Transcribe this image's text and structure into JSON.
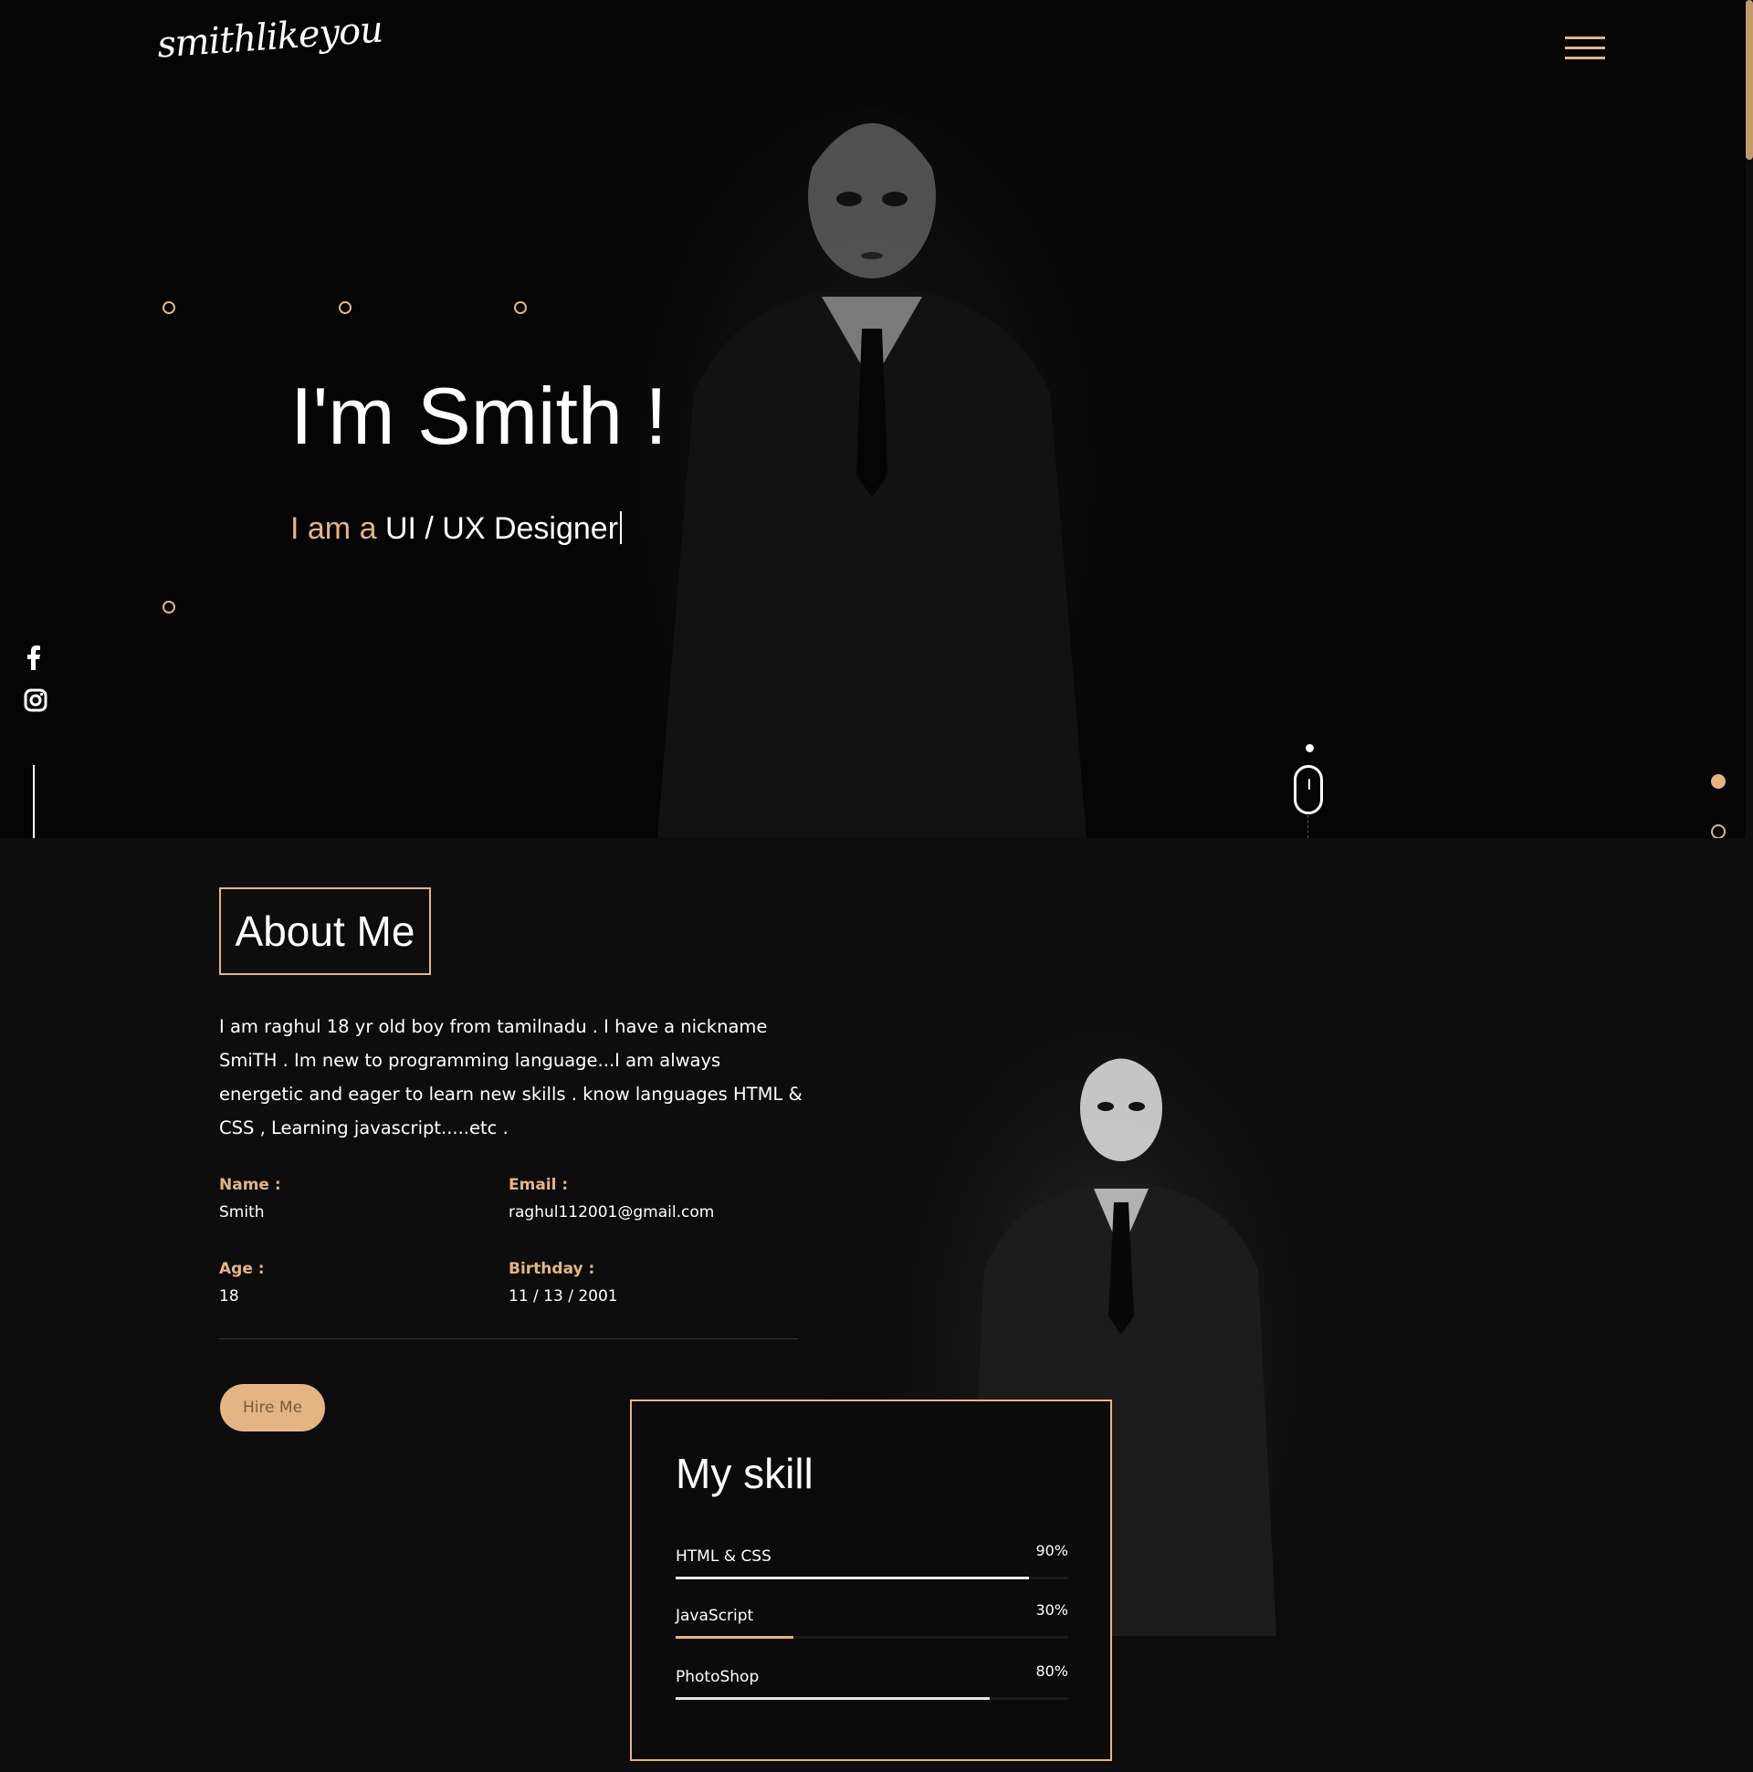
{
  "brand": {
    "logo_text": "smithlikeyou"
  },
  "hero": {
    "title": "I'm Smith !",
    "subtitle_prefix": "I am a",
    "subtitle_role": "UI / UX Designer"
  },
  "social": [
    {
      "name": "facebook",
      "icon": "facebook-icon"
    },
    {
      "name": "instagram",
      "icon": "instagram-icon"
    }
  ],
  "about": {
    "title": "About Me",
    "bio": "I am raghul 18 yr old boy from tamilnadu . I have a nickname SmiTH . Im new to programming language...I am always energetic and eager to learn new skills . know languages HTML & CSS , Learning javascript.....etc .",
    "info": {
      "name_label": "Name :",
      "name_value": "Smith",
      "email_label": "Email :",
      "email_value": "raghul112001@gmail.com",
      "age_label": "Age :",
      "age_value": "18",
      "birthday_label": "Birthday :",
      "birthday_value": "11 / 13 / 2001"
    },
    "hire_button": "Hire Me"
  },
  "skills": {
    "title": "My skill",
    "items": [
      {
        "name": "HTML & CSS",
        "percent_label": "90%",
        "level": 0.9,
        "color": "#e8e8e8"
      },
      {
        "name": "JavaScript",
        "percent_label": "30%",
        "level": 0.3,
        "color": "#e4b583"
      },
      {
        "name": "PhotoShop",
        "percent_label": "80%",
        "level": 0.8,
        "color": "#e8e8e8"
      }
    ]
  },
  "theme": {
    "accent": "#e4b583",
    "background": "#0d0d0d",
    "text": "#ffffff"
  },
  "pagination": {
    "active_index": 0,
    "count": 2
  }
}
